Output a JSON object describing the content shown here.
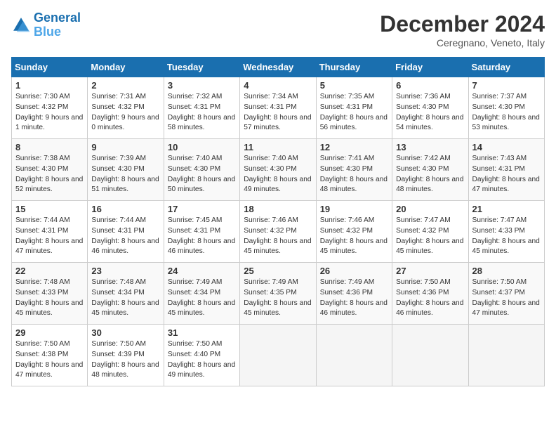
{
  "header": {
    "logo_line1": "General",
    "logo_line2": "Blue",
    "month": "December 2024",
    "location": "Ceregnano, Veneto, Italy"
  },
  "weekdays": [
    "Sunday",
    "Monday",
    "Tuesday",
    "Wednesday",
    "Thursday",
    "Friday",
    "Saturday"
  ],
  "weeks": [
    [
      {
        "day": "1",
        "sunrise": "7:30 AM",
        "sunset": "4:32 PM",
        "daylight": "9 hours and 1 minute."
      },
      {
        "day": "2",
        "sunrise": "7:31 AM",
        "sunset": "4:32 PM",
        "daylight": "9 hours and 0 minutes."
      },
      {
        "day": "3",
        "sunrise": "7:32 AM",
        "sunset": "4:31 PM",
        "daylight": "8 hours and 58 minutes."
      },
      {
        "day": "4",
        "sunrise": "7:34 AM",
        "sunset": "4:31 PM",
        "daylight": "8 hours and 57 minutes."
      },
      {
        "day": "5",
        "sunrise": "7:35 AM",
        "sunset": "4:31 PM",
        "daylight": "8 hours and 56 minutes."
      },
      {
        "day": "6",
        "sunrise": "7:36 AM",
        "sunset": "4:30 PM",
        "daylight": "8 hours and 54 minutes."
      },
      {
        "day": "7",
        "sunrise": "7:37 AM",
        "sunset": "4:30 PM",
        "daylight": "8 hours and 53 minutes."
      }
    ],
    [
      {
        "day": "8",
        "sunrise": "7:38 AM",
        "sunset": "4:30 PM",
        "daylight": "8 hours and 52 minutes."
      },
      {
        "day": "9",
        "sunrise": "7:39 AM",
        "sunset": "4:30 PM",
        "daylight": "8 hours and 51 minutes."
      },
      {
        "day": "10",
        "sunrise": "7:40 AM",
        "sunset": "4:30 PM",
        "daylight": "8 hours and 50 minutes."
      },
      {
        "day": "11",
        "sunrise": "7:40 AM",
        "sunset": "4:30 PM",
        "daylight": "8 hours and 49 minutes."
      },
      {
        "day": "12",
        "sunrise": "7:41 AM",
        "sunset": "4:30 PM",
        "daylight": "8 hours and 48 minutes."
      },
      {
        "day": "13",
        "sunrise": "7:42 AM",
        "sunset": "4:30 PM",
        "daylight": "8 hours and 48 minutes."
      },
      {
        "day": "14",
        "sunrise": "7:43 AM",
        "sunset": "4:31 PM",
        "daylight": "8 hours and 47 minutes."
      }
    ],
    [
      {
        "day": "15",
        "sunrise": "7:44 AM",
        "sunset": "4:31 PM",
        "daylight": "8 hours and 47 minutes."
      },
      {
        "day": "16",
        "sunrise": "7:44 AM",
        "sunset": "4:31 PM",
        "daylight": "8 hours and 46 minutes."
      },
      {
        "day": "17",
        "sunrise": "7:45 AM",
        "sunset": "4:31 PM",
        "daylight": "8 hours and 46 minutes."
      },
      {
        "day": "18",
        "sunrise": "7:46 AM",
        "sunset": "4:32 PM",
        "daylight": "8 hours and 45 minutes."
      },
      {
        "day": "19",
        "sunrise": "7:46 AM",
        "sunset": "4:32 PM",
        "daylight": "8 hours and 45 minutes."
      },
      {
        "day": "20",
        "sunrise": "7:47 AM",
        "sunset": "4:32 PM",
        "daylight": "8 hours and 45 minutes."
      },
      {
        "day": "21",
        "sunrise": "7:47 AM",
        "sunset": "4:33 PM",
        "daylight": "8 hours and 45 minutes."
      }
    ],
    [
      {
        "day": "22",
        "sunrise": "7:48 AM",
        "sunset": "4:33 PM",
        "daylight": "8 hours and 45 minutes."
      },
      {
        "day": "23",
        "sunrise": "7:48 AM",
        "sunset": "4:34 PM",
        "daylight": "8 hours and 45 minutes."
      },
      {
        "day": "24",
        "sunrise": "7:49 AM",
        "sunset": "4:34 PM",
        "daylight": "8 hours and 45 minutes."
      },
      {
        "day": "25",
        "sunrise": "7:49 AM",
        "sunset": "4:35 PM",
        "daylight": "8 hours and 45 minutes."
      },
      {
        "day": "26",
        "sunrise": "7:49 AM",
        "sunset": "4:36 PM",
        "daylight": "8 hours and 46 minutes."
      },
      {
        "day": "27",
        "sunrise": "7:50 AM",
        "sunset": "4:36 PM",
        "daylight": "8 hours and 46 minutes."
      },
      {
        "day": "28",
        "sunrise": "7:50 AM",
        "sunset": "4:37 PM",
        "daylight": "8 hours and 47 minutes."
      }
    ],
    [
      {
        "day": "29",
        "sunrise": "7:50 AM",
        "sunset": "4:38 PM",
        "daylight": "8 hours and 47 minutes."
      },
      {
        "day": "30",
        "sunrise": "7:50 AM",
        "sunset": "4:39 PM",
        "daylight": "8 hours and 48 minutes."
      },
      {
        "day": "31",
        "sunrise": "7:50 AM",
        "sunset": "4:40 PM",
        "daylight": "8 hours and 49 minutes."
      },
      null,
      null,
      null,
      null
    ]
  ]
}
